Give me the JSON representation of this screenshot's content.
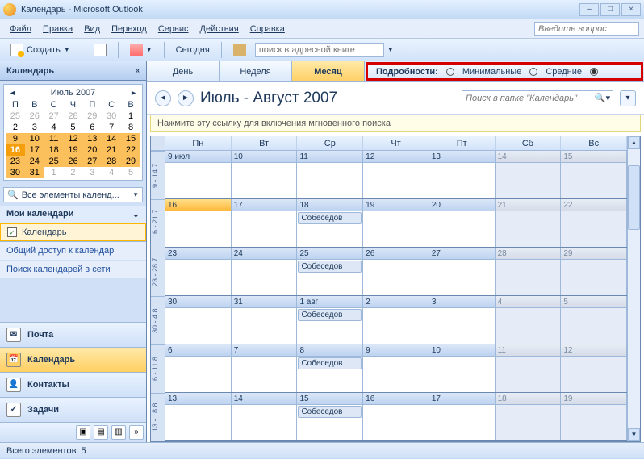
{
  "window": {
    "title": "Календарь - Microsoft Outlook"
  },
  "menubar": {
    "file": "Файл",
    "edit": "Правка",
    "view": "Вид",
    "go": "Переход",
    "tools": "Сервис",
    "actions": "Действия",
    "help": "Справка",
    "help_placeholder": "Введите вопрос"
  },
  "toolbar": {
    "new": "Создать",
    "today": "Сегодня",
    "addr_placeholder": "поиск в адресной книге"
  },
  "sidebar": {
    "title": "Календарь",
    "mini": {
      "title": "Июль 2007",
      "dow": [
        "П",
        "В",
        "С",
        "Ч",
        "П",
        "С",
        "В"
      ],
      "weeks": [
        [
          {
            "d": 25,
            "dim": true
          },
          {
            "d": 26,
            "dim": true
          },
          {
            "d": 27,
            "dim": true
          },
          {
            "d": 28,
            "dim": true
          },
          {
            "d": 29,
            "dim": true
          },
          {
            "d": 30,
            "dim": true
          },
          {
            "d": 1
          }
        ],
        [
          {
            "d": 2
          },
          {
            "d": 3
          },
          {
            "d": 4
          },
          {
            "d": 5
          },
          {
            "d": 6
          },
          {
            "d": 7
          },
          {
            "d": 8
          }
        ],
        [
          {
            "d": 9,
            "hl": true
          },
          {
            "d": 10,
            "hl": true
          },
          {
            "d": 11,
            "hl": true
          },
          {
            "d": 12,
            "hl": true
          },
          {
            "d": 13,
            "hl": true
          },
          {
            "d": 14,
            "hl": true
          },
          {
            "d": 15,
            "hl": true
          }
        ],
        [
          {
            "d": 16,
            "today": true
          },
          {
            "d": 17,
            "hl": true
          },
          {
            "d": 18,
            "hl": true
          },
          {
            "d": 19,
            "hl": true
          },
          {
            "d": 20,
            "hl": true
          },
          {
            "d": 21,
            "hl": true
          },
          {
            "d": 22,
            "hl": true
          }
        ],
        [
          {
            "d": 23,
            "hl": true
          },
          {
            "d": 24,
            "hl": true
          },
          {
            "d": 25,
            "hl": true
          },
          {
            "d": 26,
            "hl": true
          },
          {
            "d": 27,
            "hl": true
          },
          {
            "d": 28,
            "hl": true
          },
          {
            "d": 29,
            "hl": true
          }
        ],
        [
          {
            "d": 30,
            "hl": true
          },
          {
            "d": 31,
            "hl": true
          },
          {
            "d": 1,
            "dim": true
          },
          {
            "d": 2,
            "dim": true
          },
          {
            "d": 3,
            "dim": true
          },
          {
            "d": 4,
            "dim": true
          },
          {
            "d": 5,
            "dim": true
          }
        ]
      ]
    },
    "all_items": "Все элементы календ...",
    "my_cals": "Мои календари",
    "cal_item": "Календарь",
    "link_share": "Общий доступ к календар",
    "link_search": "Поиск календарей в сети",
    "nav": {
      "mail": "Почта",
      "calendar": "Календарь",
      "contacts": "Контакты",
      "tasks": "Задачи"
    }
  },
  "views": {
    "day": "День",
    "week": "Неделя",
    "month": "Месяц"
  },
  "detail": {
    "label": "Подробности:",
    "min": "Минимальные",
    "med": "Средние"
  },
  "range": "Июль - Август 2007",
  "search_placeholder": "Поиск в папке \"Календарь\"",
  "hint": "Нажмите эту ссылку для включения мгновенного поиска",
  "dow": [
    "Пн",
    "Вт",
    "Ср",
    "Чт",
    "Пт",
    "Сб",
    "Вс"
  ],
  "wknums": [
    "9 - 14.7",
    "16 - 21.7",
    "23 - 28.7",
    "30 - 4.8",
    "6 - 11.8",
    "13 - 18.8"
  ],
  "weeks": [
    [
      {
        "l": "9 июл"
      },
      {
        "l": "10"
      },
      {
        "l": "11"
      },
      {
        "l": "12"
      },
      {
        "l": "13"
      },
      {
        "l": "14",
        "dim": true
      },
      {
        "l": "15",
        "dim": true
      }
    ],
    [
      {
        "l": "16",
        "today": true
      },
      {
        "l": "17"
      },
      {
        "l": "18",
        "ev": "Собеседов"
      },
      {
        "l": "19"
      },
      {
        "l": "20"
      },
      {
        "l": "21",
        "dim": true
      },
      {
        "l": "22",
        "dim": true
      }
    ],
    [
      {
        "l": "23"
      },
      {
        "l": "24"
      },
      {
        "l": "25",
        "ev": "Собеседов"
      },
      {
        "l": "26"
      },
      {
        "l": "27"
      },
      {
        "l": "28",
        "dim": true
      },
      {
        "l": "29",
        "dim": true
      }
    ],
    [
      {
        "l": "30"
      },
      {
        "l": "31"
      },
      {
        "l": "1 авг",
        "ev": "Собеседов"
      },
      {
        "l": "2"
      },
      {
        "l": "3"
      },
      {
        "l": "4",
        "dim": true
      },
      {
        "l": "5",
        "dim": true
      }
    ],
    [
      {
        "l": "6"
      },
      {
        "l": "7"
      },
      {
        "l": "8",
        "ev": "Собеседов"
      },
      {
        "l": "9"
      },
      {
        "l": "10"
      },
      {
        "l": "11",
        "dim": true
      },
      {
        "l": "12",
        "dim": true
      }
    ],
    [
      {
        "l": "13"
      },
      {
        "l": "14"
      },
      {
        "l": "15",
        "ev": "Собеседов"
      },
      {
        "l": "16"
      },
      {
        "l": "17"
      },
      {
        "l": "18",
        "dim": true
      },
      {
        "l": "19",
        "dim": true
      }
    ]
  ],
  "status": "Всего элементов: 5"
}
